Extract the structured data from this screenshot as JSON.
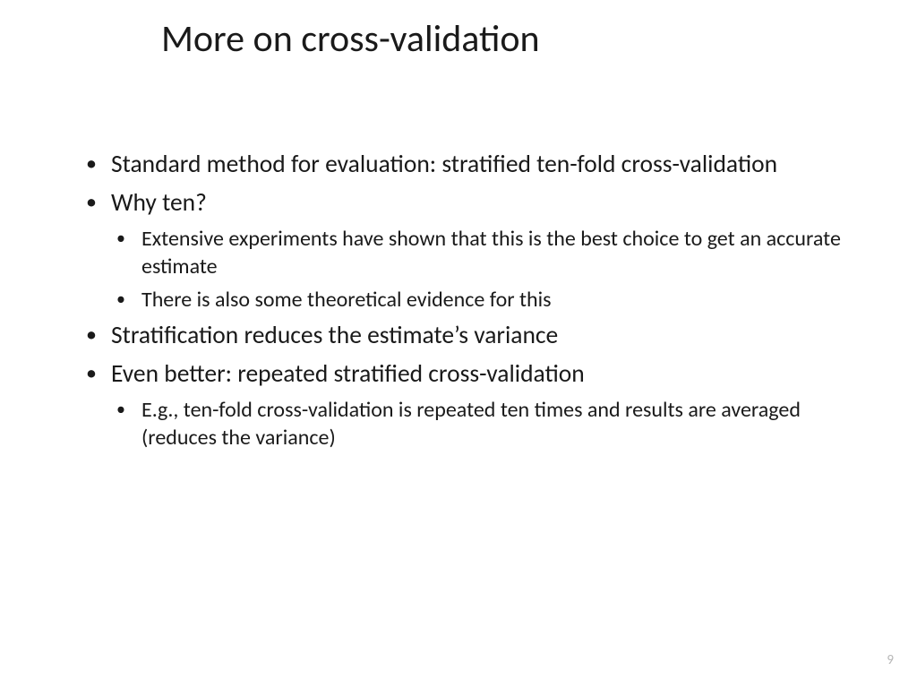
{
  "slide": {
    "title": "More on cross-validation",
    "bullets": {
      "b1": "Standard method for evaluation: stratified ten-fold cross-validation",
      "b2": "Why ten?",
      "b2_1": "Extensive experiments have shown that this is the best choice to get an accurate estimate",
      "b2_2": "There is also some theoretical evidence for this",
      "b3": "Stratification reduces the estimate’s variance",
      "b4": "Even better: repeated stratified cross-validation",
      "b4_1": "E.g., ten-fold cross-validation is repeated ten times and results are averaged (reduces the variance)"
    },
    "page_number": "9"
  }
}
